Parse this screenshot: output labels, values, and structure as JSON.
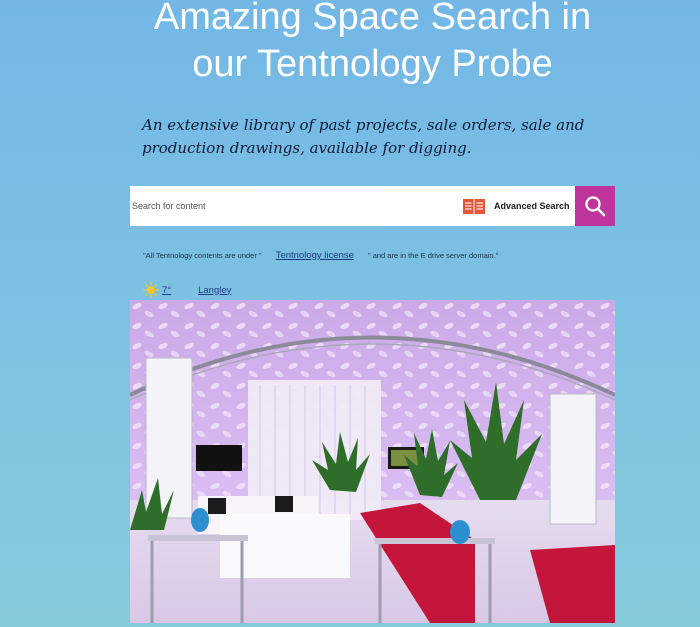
{
  "header": {
    "title": "Amazing Space Search in our Tentnology Probe",
    "subtitle": "An extensive library of past projects, sale orders, sale and production drawings, available for digging."
  },
  "search": {
    "placeholder": "Search for content",
    "value": "",
    "advanced_label": "Advanced Search",
    "advanced_icon": "open-book-icon",
    "button_icon": "search-icon",
    "button_color": "#c0359d"
  },
  "license": {
    "prefix": "\"All Tentnology contents are under \"",
    "link_text": "Tentnology license",
    "suffix": "\" and are in the E drive server domain.\""
  },
  "weather": {
    "icon": "sun-icon",
    "temperature": "7°",
    "location": "Langley"
  },
  "hero_image": {
    "subject": "event-tent-interior-photo"
  }
}
